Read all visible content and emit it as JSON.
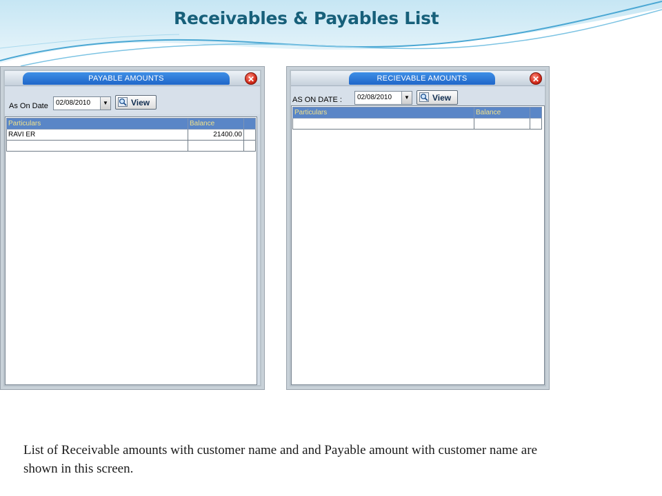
{
  "slide": {
    "title": "Receivables & Payables List",
    "caption": "List of  Receivable amounts with customer name and  and Payable amount with customer name are shown in this screen."
  },
  "payable_window": {
    "title": "PAYABLE AMOUNTS",
    "close_icon": "close-icon",
    "date_label": "As On Date",
    "date_value": "02/08/2010",
    "view_label": "View",
    "columns": [
      "Particulars",
      "Balance"
    ],
    "rows": [
      {
        "particulars": "RAVI ER",
        "balance": "21400.00"
      },
      {
        "particulars": "",
        "balance": ""
      }
    ]
  },
  "receivable_window": {
    "title": "RECIEVABLE AMOUNTS",
    "close_icon": "close-icon",
    "date_label": "AS ON DATE :",
    "date_value": "02/08/2010",
    "view_label": "View",
    "columns": [
      "Particulars",
      "Balance"
    ],
    "rows": [
      {
        "particulars": "",
        "balance": ""
      }
    ]
  },
  "colors": {
    "title": "#17607a",
    "grid_header_bg": "#5a86c7",
    "grid_header_text": "#f2e28a",
    "window_bg": "#d3dce6"
  }
}
